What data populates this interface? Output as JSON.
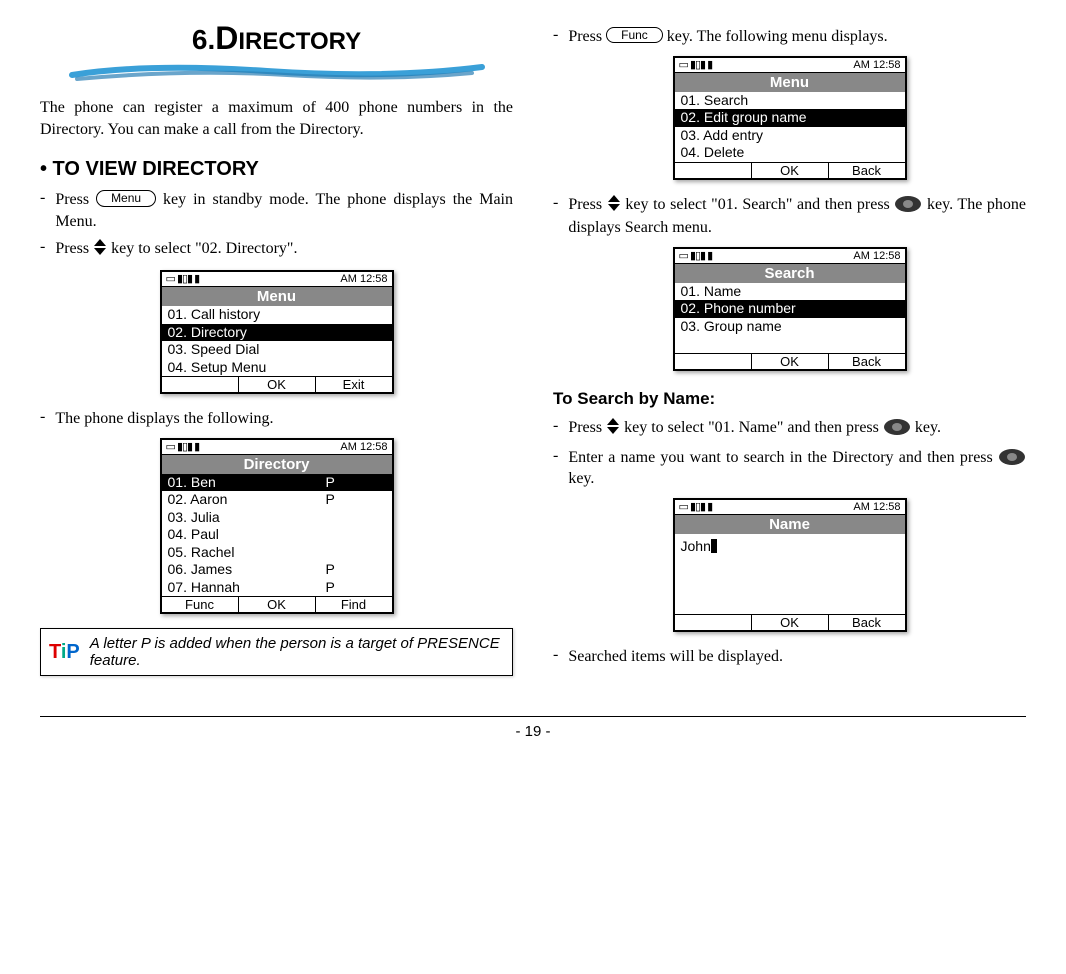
{
  "header": {
    "num": "6.",
    "first": "D",
    "rest": "IRECTORY"
  },
  "intro": "The phone can register a maximum of 400 phone numbers in the Directory. You can make a call from the Directory.",
  "section1": "• TO VIEW DIRECTORY",
  "step1a_pre": "Press ",
  "step1a_key": "Menu",
  "step1a_post": " key in standby mode. The phone displays the Main Menu.",
  "step1b_pre": "Press ",
  "step1b_post": " key to select \"02. Directory\".",
  "step1c": "The phone displays the following.",
  "screen_time": "AM 12:58",
  "screen_icons": "▭ ▮▯▮ ▮",
  "menu_screen": {
    "title": "Menu",
    "items": [
      "01. Call history",
      "02. Directory",
      "03. Speed Dial",
      "04. Setup Menu"
    ],
    "soft": [
      "",
      "OK",
      "Exit"
    ]
  },
  "dir_screen": {
    "title": "Directory",
    "rows": [
      {
        "n": "01. Ben",
        "p": "P",
        "sel": true
      },
      {
        "n": "02. Aaron",
        "p": "P"
      },
      {
        "n": "03. Julia",
        "p": ""
      },
      {
        "n": "04. Paul",
        "p": ""
      },
      {
        "n": "05. Rachel",
        "p": ""
      },
      {
        "n": "06. James",
        "p": "P"
      },
      {
        "n": "07. Hannah",
        "p": "P"
      }
    ],
    "soft": [
      "Func",
      "OK",
      "Find"
    ]
  },
  "tip": "A letter P is added when the person is a target of PRESENCE feature.",
  "step2a_pre": "Press ",
  "step2a_key": "Func",
  "step2a_post": " key. The following menu displays.",
  "func_screen": {
    "title": "Menu",
    "items": [
      "01. Search",
      "02. Edit group name",
      "03. Add entry",
      "04. Delete"
    ],
    "soft": [
      "",
      "OK",
      "Back"
    ]
  },
  "step2b_pre": "Press ",
  "step2b_mid": " key to select \"01. Search\" and then press ",
  "step2b_post": " key. The phone displays Search menu.",
  "search_screen": {
    "title": "Search",
    "items": [
      "01. Name",
      "02. Phone number",
      "03. Group name"
    ],
    "soft": [
      "",
      "OK",
      "Back"
    ]
  },
  "section2": "To Search by Name:",
  "step3a_pre": "Press ",
  "step3a_mid": " key to select \"01. Name\" and then press ",
  "step3a_post": " key.",
  "step3b_pre": "Enter a name you want to search in the Directory and then press ",
  "step3b_post": " key.",
  "name_screen": {
    "title": "Name",
    "value": "John",
    "soft": [
      "",
      "OK",
      "Back"
    ]
  },
  "step3c": "Searched items will be displayed.",
  "page": "- 19 -"
}
